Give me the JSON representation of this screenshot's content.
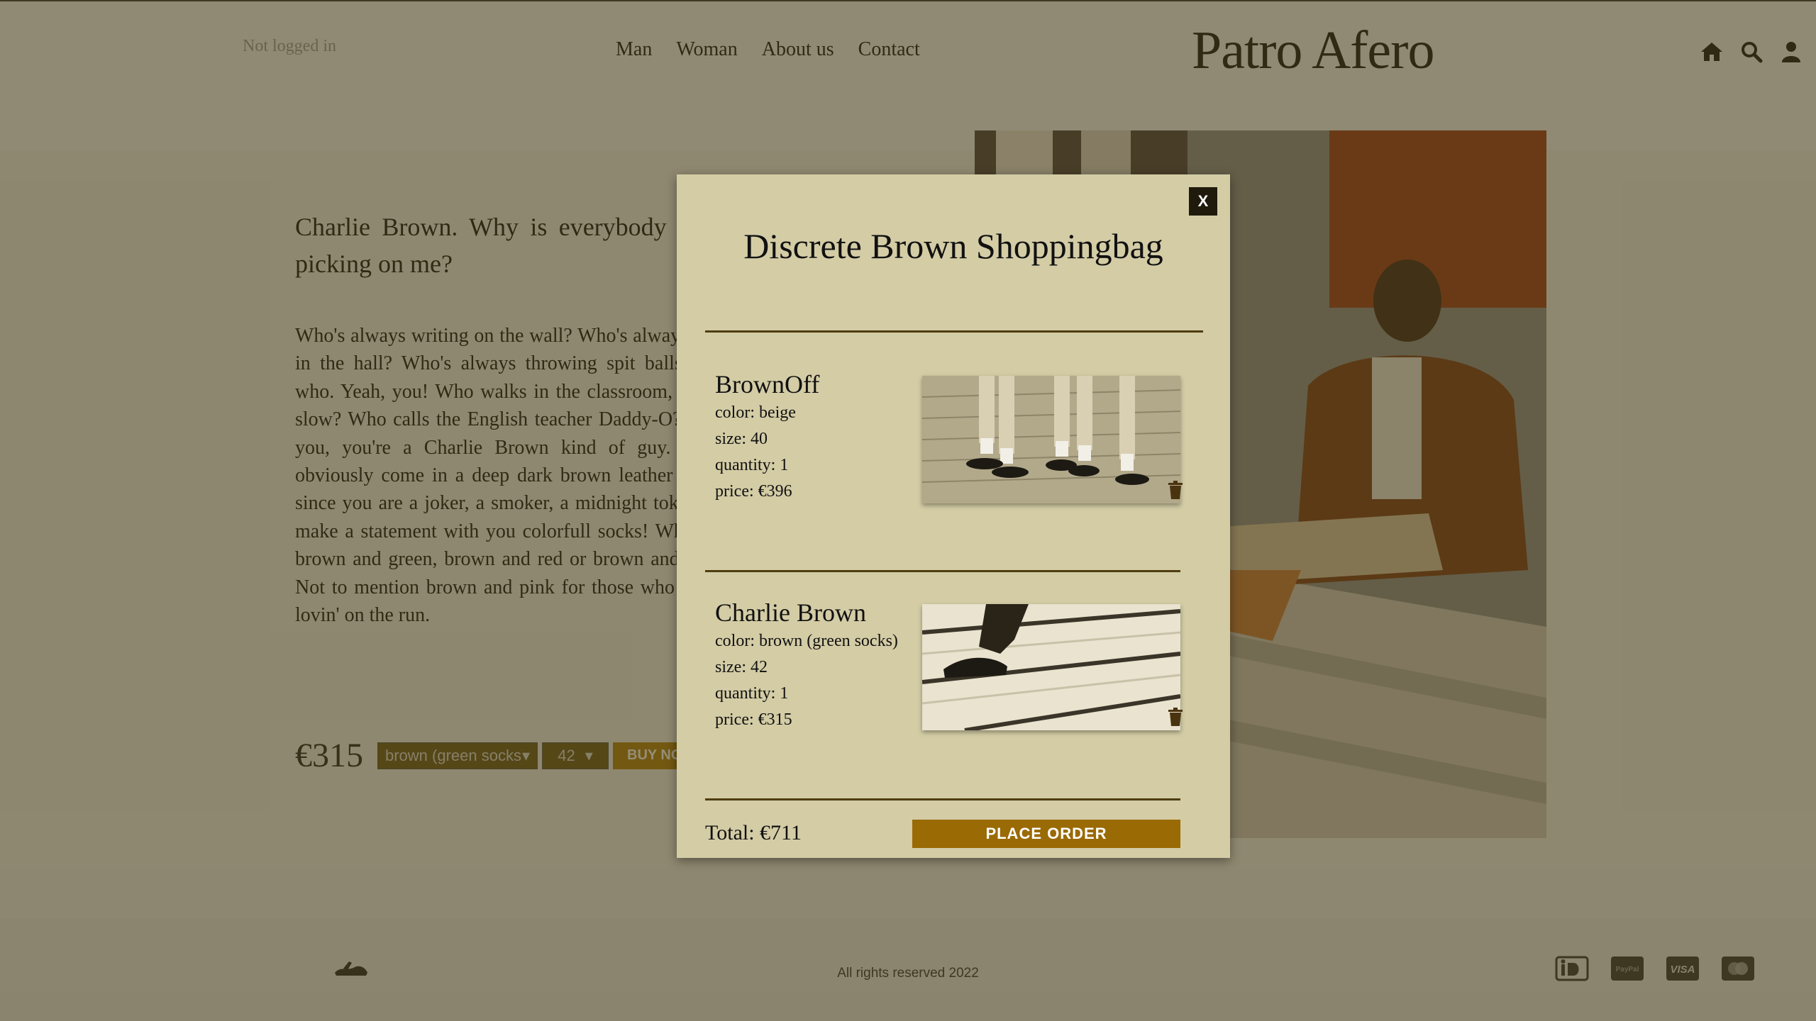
{
  "header": {
    "login_status": "Not logged in",
    "nav": [
      "Man",
      "Woman",
      "About us",
      "Contact"
    ],
    "brand": "Patro Afero",
    "icons": [
      "home-icon",
      "search-icon",
      "user-icon"
    ]
  },
  "product": {
    "heading": "Charlie Brown. Why is everybody always picking on me?",
    "description": "Who's always writing on the wall? Who's always goofin' in the hall? Who's always throwing spit balls? Guess who. Yeah, you! Who walks in the classroom, cool and slow? Who calls the English teacher Daddy-O? If that's you, you're a Charlie Brown kind of guy. Charlies obviously come in a deep dark brown leather look but since you are a joker, a smoker, a midnight toker, you'll make a statement with you colorfull socks! What about brown and green, brown and red or brown and yellow? Not to mention brown and pink for those who get their lovin' on the run.",
    "price": "€315",
    "color_select": "brown (green socks)",
    "size_select": "42",
    "buy_label": "BUY NOW"
  },
  "modal": {
    "close_label": "X",
    "title": "Discrete Brown Shoppingbag",
    "items": [
      {
        "name": "BrownOff",
        "color": "color: beige",
        "size": "size: 40",
        "quantity": "quantity: 1",
        "price": "price: €396"
      },
      {
        "name": "Charlie Brown",
        "color": "color: brown (green socks)",
        "size": "size: 42",
        "quantity": "quantity: 1",
        "price": "price: €315"
      }
    ],
    "total": "Total: €711",
    "order_label": "PLACE ORDER"
  },
  "footer": {
    "rights": "All rights reserved 2022",
    "payment_icons": [
      "ideal-icon",
      "paypal-icon",
      "visa-icon",
      "mastercard-icon"
    ]
  },
  "colors": {
    "overlay": "#463a14",
    "modal_bg": "#d3cca5",
    "accent": "#9a6a04",
    "rule": "#4f3d10"
  }
}
